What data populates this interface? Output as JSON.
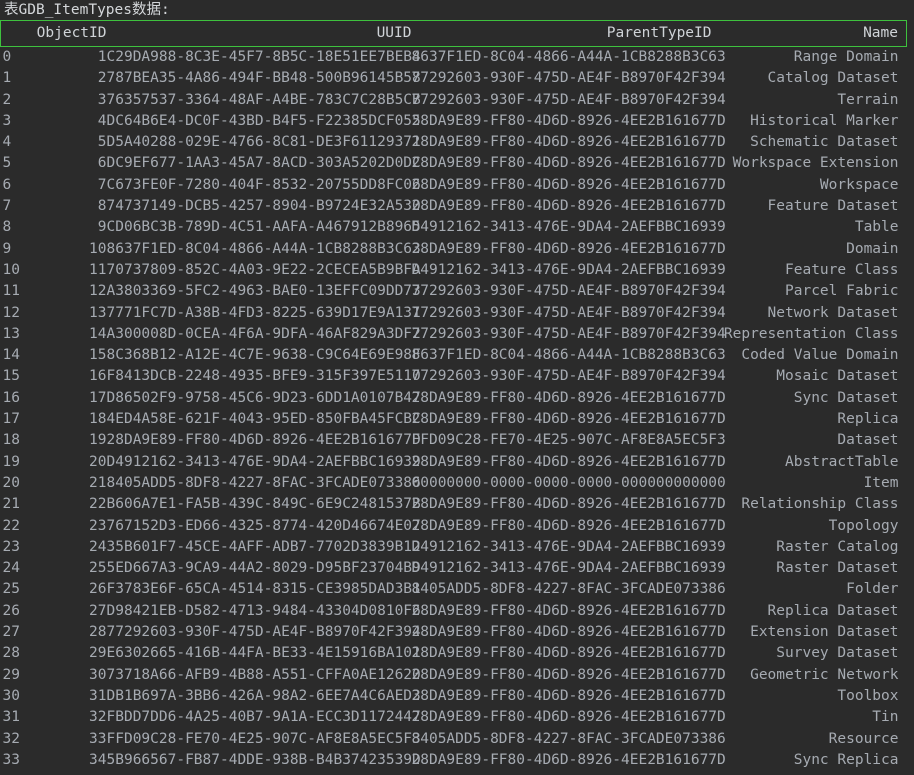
{
  "terminal": {
    "title_line": "表GDB_ItemTypes数据:",
    "background_color": "#2b2b2b",
    "text_color": "#a6abb2",
    "header_border_color": "#3ec13e"
  },
  "table": {
    "name": "GDB_ItemTypes",
    "columns": [
      "",
      "ObjectID",
      "UUID",
      "ParentTypeID",
      "Name"
    ],
    "rows": [
      [
        "0",
        "1",
        "C29DA988-8C3E-45F7-8B5C-18E51EE7BEB4",
        "8637F1ED-8C04-4866-A44A-1CB8288B3C63",
        "Range Domain"
      ],
      [
        "1",
        "2",
        "787BEA35-4A86-494F-BB48-500B96145B58",
        "77292603-930F-475D-AE4F-B8970F42F394",
        "Catalog Dataset"
      ],
      [
        "2",
        "3",
        "76357537-3364-48AF-A4BE-783C7C28B5CB",
        "77292603-930F-475D-AE4F-B8970F42F394",
        "Terrain"
      ],
      [
        "3",
        "4",
        "DC64B6E4-DC0F-43BD-B4F5-F22385DCF055",
        "28DA9E89-FF80-4D6D-8926-4EE2B161677D",
        "Historical Marker"
      ],
      [
        "4",
        "5",
        "D5A40288-029E-4766-8C81-DE3F61129371",
        "28DA9E89-FF80-4D6D-8926-4EE2B161677D",
        "Schematic Dataset"
      ],
      [
        "5",
        "6",
        "DC9EF677-1AA3-45A7-8ACD-303A5202D0DC",
        "28DA9E89-FF80-4D6D-8926-4EE2B161677D",
        "Workspace Extension"
      ],
      [
        "6",
        "7",
        "C673FE0F-7280-404F-8532-20755DD8FC06",
        "28DA9E89-FF80-4D6D-8926-4EE2B161677D",
        "Workspace"
      ],
      [
        "7",
        "8",
        "74737149-DCB5-4257-8904-B9724E32A530",
        "28DA9E89-FF80-4D6D-8926-4EE2B161677D",
        "Feature Dataset"
      ],
      [
        "8",
        "9",
        "CD06BC3B-789D-4C51-AAFA-A467912B8965",
        "D4912162-3413-476E-9DA4-2AEFBBC16939",
        "Table"
      ],
      [
        "9",
        "10",
        "8637F1ED-8C04-4866-A44A-1CB8288B3C63",
        "28DA9E89-FF80-4D6D-8926-4EE2B161677D",
        "Domain"
      ],
      [
        "10",
        "11",
        "70737809-852C-4A03-9E22-2CECEA5B9BFA",
        "D4912162-3413-476E-9DA4-2AEFBBC16939",
        "Feature Class"
      ],
      [
        "11",
        "12",
        "A3803369-5FC2-4963-BAE0-13EFFC09DD73",
        "77292603-930F-475D-AE4F-B8970F42F394",
        "Parcel Fabric"
      ],
      [
        "12",
        "13",
        "7771FC7D-A38B-4FD3-8225-639D17E9A131",
        "77292603-930F-475D-AE4F-B8970F42F394",
        "Network Dataset"
      ],
      [
        "13",
        "14",
        "A300008D-0CEA-4F6A-9DFA-46AF829A3DF2",
        "77292603-930F-475D-AE4F-B8970F42F394",
        "Representation Class"
      ],
      [
        "14",
        "15",
        "8C368B12-A12E-4C7E-9638-C9C64E69E98F",
        "8637F1ED-8C04-4866-A44A-1CB8288B3C63",
        "Coded Value Domain"
      ],
      [
        "15",
        "16",
        "F8413DCB-2248-4935-BFE9-315F397E5110",
        "77292603-930F-475D-AE4F-B8970F42F394",
        "Mosaic Dataset"
      ],
      [
        "16",
        "17",
        "D86502F9-9758-45C6-9D23-6DD1A0107B47",
        "28DA9E89-FF80-4D6D-8926-4EE2B161677D",
        "Sync Dataset"
      ],
      [
        "17",
        "18",
        "4ED4A58E-621F-4043-95ED-850FBA45FCBC",
        "28DA9E89-FF80-4D6D-8926-4EE2B161677D",
        "Replica"
      ],
      [
        "18",
        "19",
        "28DA9E89-FF80-4D6D-8926-4EE2B161677D",
        "FFD09C28-FE70-4E25-907C-AF8E8A5EC5F3",
        "Dataset"
      ],
      [
        "19",
        "20",
        "D4912162-3413-476E-9DA4-2AEFBBC16939",
        "28DA9E89-FF80-4D6D-8926-4EE2B161677D",
        "AbstractTable"
      ],
      [
        "20",
        "21",
        "8405ADD5-8DF8-4227-8FAC-3FCADE073386",
        "00000000-0000-0000-0000-000000000000",
        "Item"
      ],
      [
        "21",
        "22",
        "B606A7E1-FA5B-439C-849C-6E9C2481537B",
        "28DA9E89-FF80-4D6D-8926-4EE2B161677D",
        "Relationship Class"
      ],
      [
        "22",
        "23",
        "767152D3-ED66-4325-8774-420D46674E07",
        "28DA9E89-FF80-4D6D-8926-4EE2B161677D",
        "Topology"
      ],
      [
        "23",
        "24",
        "35B601F7-45CE-4AFF-ADB7-7702D3839B12",
        "D4912162-3413-476E-9DA4-2AEFBBC16939",
        "Raster Catalog"
      ],
      [
        "24",
        "25",
        "5ED667A3-9CA9-44A2-8029-D95BF23704B9",
        "D4912162-3413-476E-9DA4-2AEFBBC16939",
        "Raster Dataset"
      ],
      [
        "25",
        "26",
        "F3783E6F-65CA-4514-8315-CE3985DAD3B1",
        "8405ADD5-8DF8-4227-8FAC-3FCADE073386",
        "Folder"
      ],
      [
        "26",
        "27",
        "D98421EB-D582-4713-9484-43304D0810F6",
        "28DA9E89-FF80-4D6D-8926-4EE2B161677D",
        "Replica Dataset"
      ],
      [
        "27",
        "28",
        "77292603-930F-475D-AE4F-B8970F42F394",
        "28DA9E89-FF80-4D6D-8926-4EE2B161677D",
        "Extension Dataset"
      ],
      [
        "28",
        "29",
        "E6302665-416B-44FA-BE33-4E15916BA101",
        "28DA9E89-FF80-4D6D-8926-4EE2B161677D",
        "Survey Dataset"
      ],
      [
        "29",
        "30",
        "73718A66-AFB9-4B88-A551-CFFA0AE12620",
        "28DA9E89-FF80-4D6D-8926-4EE2B161677D",
        "Geometric Network"
      ],
      [
        "30",
        "31",
        "DB1B697A-3BB6-426A-98A2-6EE7A4C6AED3",
        "28DA9E89-FF80-4D6D-8926-4EE2B161677D",
        "Toolbox"
      ],
      [
        "31",
        "32",
        "FBDD7DD6-4A25-40B7-9A1A-ECC3D1172447",
        "28DA9E89-FF80-4D6D-8926-4EE2B161677D",
        "Tin"
      ],
      [
        "32",
        "33",
        "FFD09C28-FE70-4E25-907C-AF8E8A5EC5F3",
        "8405ADD5-8DF8-4227-8FAC-3FCADE073386",
        "Resource"
      ],
      [
        "33",
        "34",
        "5B966567-FB87-4DDE-938B-B4B37423539D",
        "28DA9E89-FF80-4D6D-8926-4EE2B161677D",
        "Sync Replica"
      ]
    ]
  }
}
